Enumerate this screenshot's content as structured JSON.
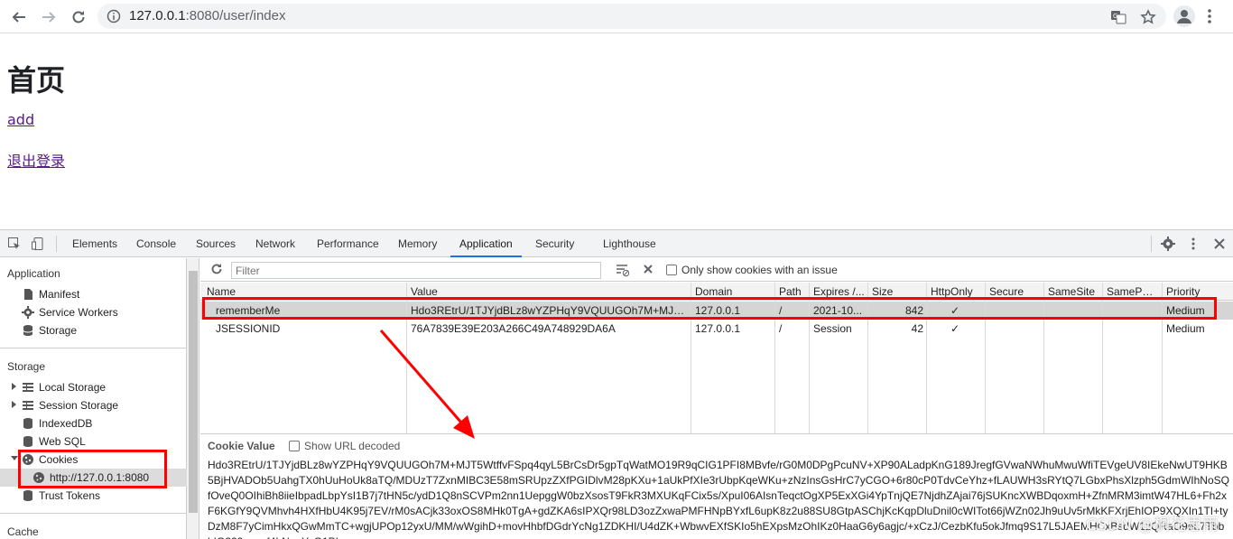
{
  "browser": {
    "url_host": "127.0.0.1",
    "url_rest": ":8080/user/index"
  },
  "page": {
    "heading": "首页",
    "link_add": "add",
    "link_logout": "退出登录"
  },
  "devtools": {
    "tabs": [
      "Elements",
      "Console",
      "Sources",
      "Network",
      "Performance",
      "Memory",
      "Application",
      "Security",
      "Lighthouse"
    ],
    "active_tab": "Application",
    "sidebar": {
      "application_header": "Application",
      "application_items": [
        "Manifest",
        "Service Workers",
        "Storage"
      ],
      "storage_header": "Storage",
      "storage_items": [
        "Local Storage",
        "Session Storage",
        "IndexedDB",
        "Web SQL",
        "Cookies"
      ],
      "cookie_origin": "http://127.0.0.1:8080",
      "trust_tokens": "Trust Tokens",
      "cache_header": "Cache"
    },
    "toolbar": {
      "filter_placeholder": "Filter",
      "only_issue_label": "Only show cookies with an issue"
    },
    "columns": [
      "Name",
      "Value",
      "Domain",
      "Path",
      "Expires /...",
      "Size",
      "HttpOnly",
      "Secure",
      "SameSite",
      "SameParty",
      "Priority"
    ],
    "rows": [
      {
        "name": "rememberMe",
        "value": "Hdo3REtrU/1TJYjdBLz8wYZPHqY9VQUUGOh7M+MJT5...",
        "domain": "127.0.0.1",
        "path": "/",
        "expires": "2021-10...",
        "size": "842",
        "httponly": "✓",
        "secure": "",
        "samesite": "",
        "sameparty": "",
        "priority": "Medium"
      },
      {
        "name": "JSESSIONID",
        "value": "76A7839E39E203A266C49A748929DA6A",
        "domain": "127.0.0.1",
        "path": "/",
        "expires": "Session",
        "size": "42",
        "httponly": "✓",
        "secure": "",
        "samesite": "",
        "sameparty": "",
        "priority": "Medium"
      }
    ],
    "value_pane": {
      "title": "Cookie Value",
      "decode_label": "Show URL decoded",
      "value": "Hdo3REtrU/1TJYjdBLz8wYZPHqY9VQUUGOh7M+MJT5WtffvFSpq4qyL5BrCsDr5gpTqWatMO19R9qCIG1PFI8MBvfe/rG0M0DPgPcuNV+XP90ALadpKnG189JregfGVwaNWhuMwuWfiTEVgeUV8IEkeNwUT9HKB5BjHVADOb5UahgTX0hUuHoUk8aTQ/MDUzT7ZxnMIBC3E58mSRUpzZXfPGIDlvM28pKXu+1aUkPfXIe3rUbpKqeWKu+zNzInsGsHrC7yCGO+6r80cP0TdvCeYhz+fLAUWH3sRYtQ7LGbxPhsXlzph5GdmWIhNoSQfOveQ0OIhiBh8iieIbpadLbpYsI1B7j7tHN5c/ydD1Q8nSCVPm2nn1UepggW0bzXsosT9FkR3MXUKqFCix5s/XpuI06AIsnTeqctOgXP5ExXGi4YpTnjQE7NjdhZAjai76jSUKncXWBDqoxmH+ZfnMRM3imtW47HL6+Fh2xF6KGfY9QVMhvh4HXfHbU4K95j7EV/rM0sACjk33oxOS8MHk0TgA+gdZKA6sIPXQr98LD3ozZxwaPMFHNpBYxfL6upK8z2u88SU8GtpASChjKcKqpDluDnil0cWITot66jWZn02Jh9uUv5rMkKFXrjEhIOP9XQXIn1TI+tyDzM8F7yCimHkxQGwMmTC+wgjUPOp12yxU/MM/wWgihD+movHhbfDGdrYcNg1ZDKHI/U4dZK+WbwvEXfSKIo5hEXpsMzOhIKz0HaaG6y6agjc/+xCzJ/CezbKfu5okJfmq9S17L5JAEMHCxBsdW1zQRaO9eL7TbbhIG229ovnuf4LNquYqG1PI"
    }
  },
  "watermark": "CSDN @桐花思雨"
}
